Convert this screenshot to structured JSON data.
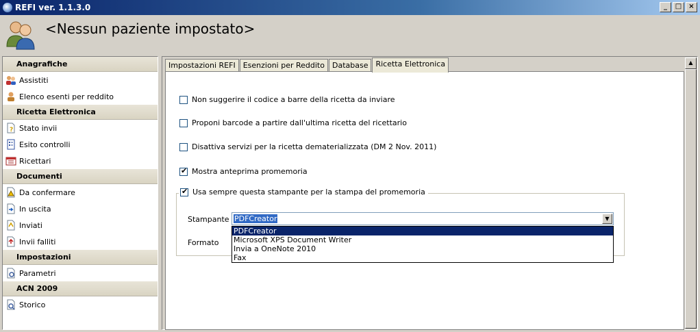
{
  "window": {
    "title": "REFI  ver. 1.1.3.0",
    "buttons": {
      "minimize": "_",
      "maximize": "□",
      "close": "×"
    }
  },
  "header": {
    "patient_title": "<Nessun paziente impostato>"
  },
  "sidebar": {
    "sections": [
      {
        "label": "Anagrafiche",
        "items": [
          {
            "label": "Assistiti",
            "icon": "people-icon"
          },
          {
            "label": "Elenco esenti per reddito",
            "icon": "person-icon"
          }
        ]
      },
      {
        "label": "Ricetta Elettronica",
        "items": [
          {
            "label": "Stato invii",
            "icon": "document-question-icon"
          },
          {
            "label": "Esito controlli",
            "icon": "checklist-icon"
          },
          {
            "label": "Ricettari",
            "icon": "calendar-icon"
          }
        ]
      },
      {
        "label": "Documenti",
        "items": [
          {
            "label": "Da confermare",
            "icon": "document-warning-icon"
          },
          {
            "label": "In uscita",
            "icon": "document-outgoing-icon"
          },
          {
            "label": "Inviati",
            "icon": "document-sent-icon"
          },
          {
            "label": "Invii falliti",
            "icon": "document-failed-icon"
          }
        ]
      },
      {
        "label": "Impostazioni",
        "items": [
          {
            "label": "Parametri",
            "icon": "settings-icon"
          }
        ]
      },
      {
        "label": "ACN 2009",
        "items": [
          {
            "label": "Storico",
            "icon": "history-icon"
          }
        ]
      }
    ]
  },
  "tabs": [
    {
      "label": "Impostazioni REFI",
      "active": false
    },
    {
      "label": "Esenzioni per Reddito",
      "active": false
    },
    {
      "label": "Database",
      "active": false
    },
    {
      "label": "Ricetta Elettronica",
      "active": true
    }
  ],
  "options": {
    "no_barcode_suggest": {
      "label": "Non suggerire il codice a barre della ricetta da inviare",
      "checked": false
    },
    "propose_barcode": {
      "label": "Proponi barcode a partire dall'ultima ricetta del ricettario",
      "checked": false
    },
    "disable_services": {
      "label": "Disattiva servizi per la ricetta dematerializzata (DM 2 Nov. 2011)",
      "checked": false
    },
    "show_preview": {
      "label": "Mostra anteprima promemoria",
      "checked": true
    },
    "always_use_printer": {
      "label": "Usa sempre questa stampante per la stampa del promemoria",
      "checked": true
    }
  },
  "printer": {
    "stampante_label": "Stampante",
    "formato_label": "Formato",
    "selected": "PDFCreator",
    "options": [
      "PDFCreator",
      "Microsoft XPS Document Writer",
      "Invia a OneNote 2010",
      "Fax"
    ]
  },
  "colors": {
    "title_bar": "#0a246a",
    "selection": "#316ac5",
    "section_bg": "#dedacb"
  }
}
